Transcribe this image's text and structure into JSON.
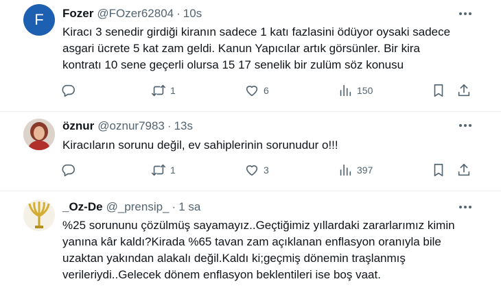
{
  "tweets": [
    {
      "avatar_letter": "F",
      "name": "Fozer",
      "handle": "@FOzer62804",
      "dot": "·",
      "time": "10s",
      "lines": [
        "Kiracı 3 senedir girdiği kiranın sadece 1 katı fazlasini ödüyor oysaki sadece",
        "asgari ücrete 5 kat zam geldi. Kanun Yapıcılar artık görsünler. Bir kira",
        "kontratı 10 sene geçerli olursa 15 17 senelik bir zulüm söz konusu"
      ],
      "replies": "",
      "retweets": "1",
      "likes": "6",
      "views": "150"
    },
    {
      "name": "öznur",
      "handle": "@oznur7983",
      "dot": "·",
      "time": "13s",
      "lines": [
        "Kiracıların sorunu değil, ev sahiplerinin sorunudur o!!!"
      ],
      "replies": "",
      "retweets": "1",
      "likes": "3",
      "views": "397"
    },
    {
      "name": "_Oz-De",
      "handle": "@_prensip_",
      "dot": "·",
      "time": "1 sa",
      "lines": [
        "%25 sorununu çözülmüş sayamayız..Geçtiğimiz yıllardaki zararlarımız kimin",
        "yanına kâr kaldı?Kirada %65 tavan zam açıklanan enflasyon oranıyla bile",
        "uzaktan yakından alakalı değil.Kaldı ki;geçmiş dönemin traşlanmış",
        "verileriydi..Gelecek dönem enflasyon beklentileri ise boş vaat."
      ]
    }
  ],
  "colors": {
    "text": "#0f1419",
    "muted": "#536471",
    "avatar_f": "#1d5fb0",
    "divider": "#eff3f4"
  },
  "icons": [
    "more-icon",
    "reply-icon",
    "retweet-icon",
    "like-icon",
    "views-icon",
    "bookmark-icon",
    "share-icon"
  ]
}
